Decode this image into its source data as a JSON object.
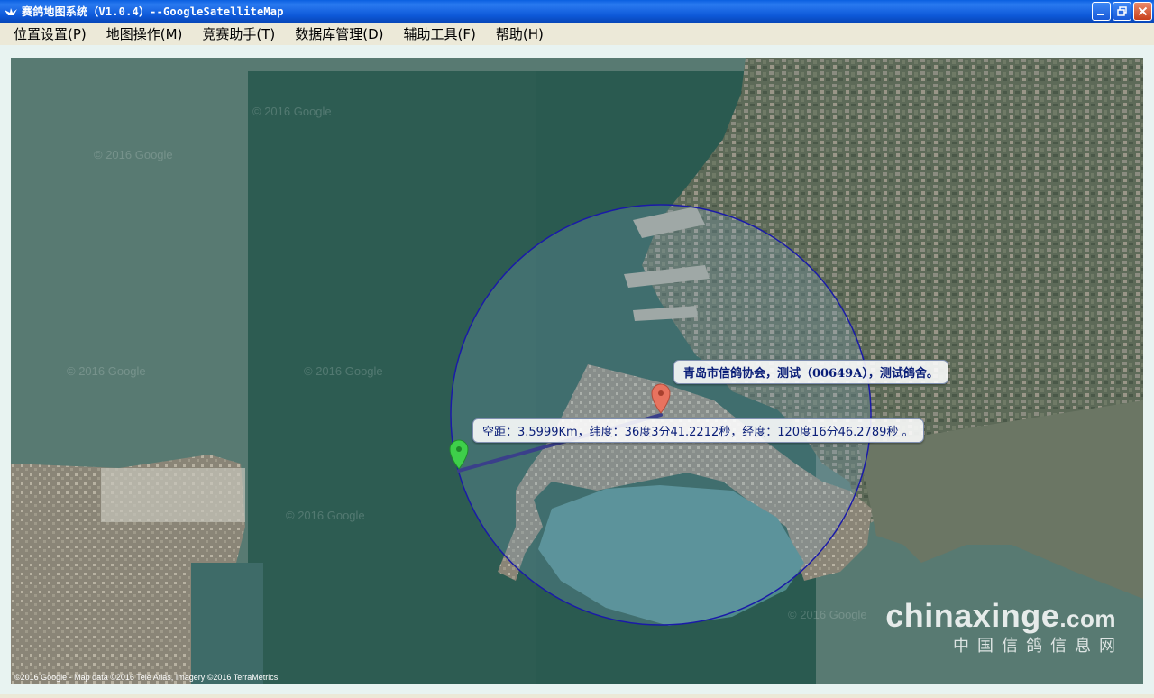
{
  "window": {
    "title": "赛鸽地图系统（V1.0.4）--GoogleSatelliteMap",
    "controls": [
      "minimize-button",
      "maximize-button",
      "close-button"
    ]
  },
  "menu": [
    {
      "label": "位置设置(P)"
    },
    {
      "label": "地图操作(M)"
    },
    {
      "label": "竞赛助手(T)"
    },
    {
      "label": "数据库管理(D)"
    },
    {
      "label": "辅助工具(F)"
    },
    {
      "label": "帮助(H)"
    }
  ],
  "map": {
    "loft_label": "青岛市信鸽协会，测试（00649A），测试鸽舍。",
    "distance_label": "空距：3.5999Km，纬度：36度3分41.2212秒，经度：120度16分46.2789秒 。",
    "attribution": "©2016 Google - Map data ©2016 Tele Atlas, Imagery ©2016 TerraMetrics",
    "tile_watermark": "© 2016 Google",
    "brand": "chinaxinge",
    "brand_suffix": ".com",
    "brand_sub": "中国信鸽信息网",
    "colors": {
      "circle": "#1a1aa8",
      "line": "#3a3f8a",
      "marker_origin": "#e8735f",
      "marker_point": "#3ecf4a"
    }
  }
}
